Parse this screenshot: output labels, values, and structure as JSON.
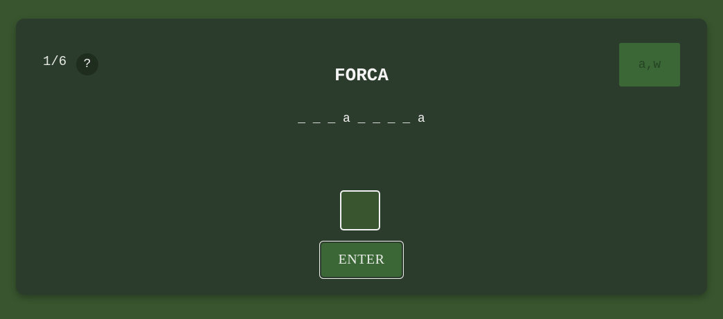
{
  "game": {
    "title": "FORCA",
    "counter": "1/6",
    "help_label": "?",
    "guessed_letters": "a,w",
    "word_display": "_ _ _ a _ _ _ _ a",
    "letter_input_value": "",
    "enter_label": "ENTER"
  },
  "colors": {
    "page_background": "#38552f",
    "card_background": "#2c3c2c",
    "accent_green": "#3b6736",
    "help_background": "#1e2d1d",
    "text": "#f0f0f0"
  },
  "icons": {
    "help": "question-mark"
  }
}
